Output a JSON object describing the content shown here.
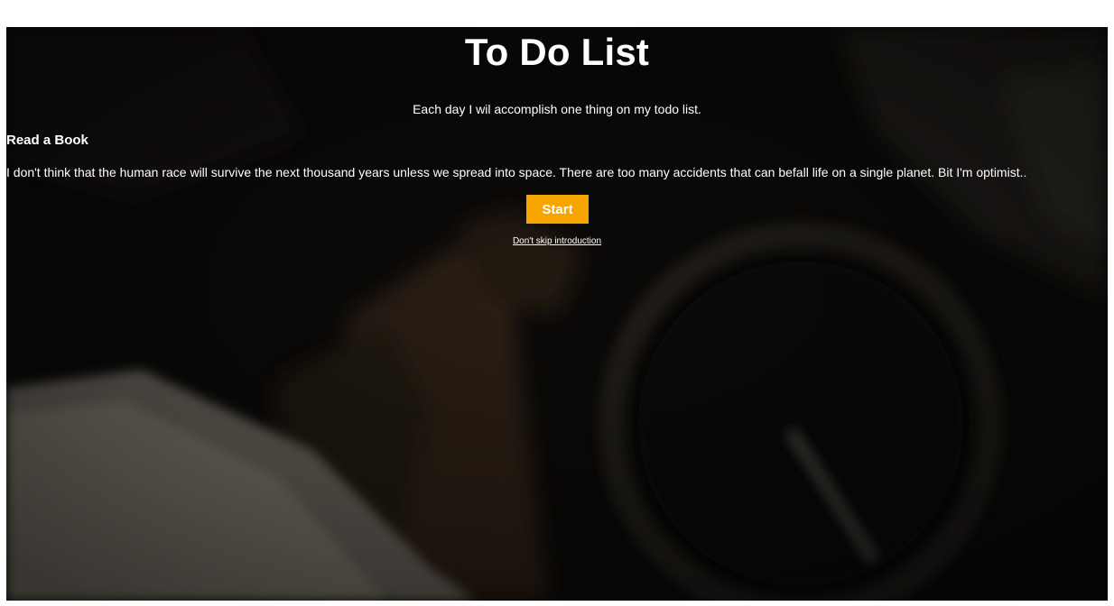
{
  "page": {
    "title": "To Do List",
    "tagline": "Each day I wil accomplish one thing on my todo list."
  },
  "item": {
    "title": "Read a Book",
    "description": "I don't think that the human race will survive the next thousand years unless we spread into space. There are too many accidents that can befall life on a single planet. Bit I'm optimist.."
  },
  "actions": {
    "start_label": "Start",
    "skip_label": "Don't skip introduction"
  },
  "colors": {
    "accent": "#f7a300",
    "text": "#ffffff",
    "background": "#0f0d0b"
  },
  "background_image": "blurred-desk-photo-book-and-watch"
}
